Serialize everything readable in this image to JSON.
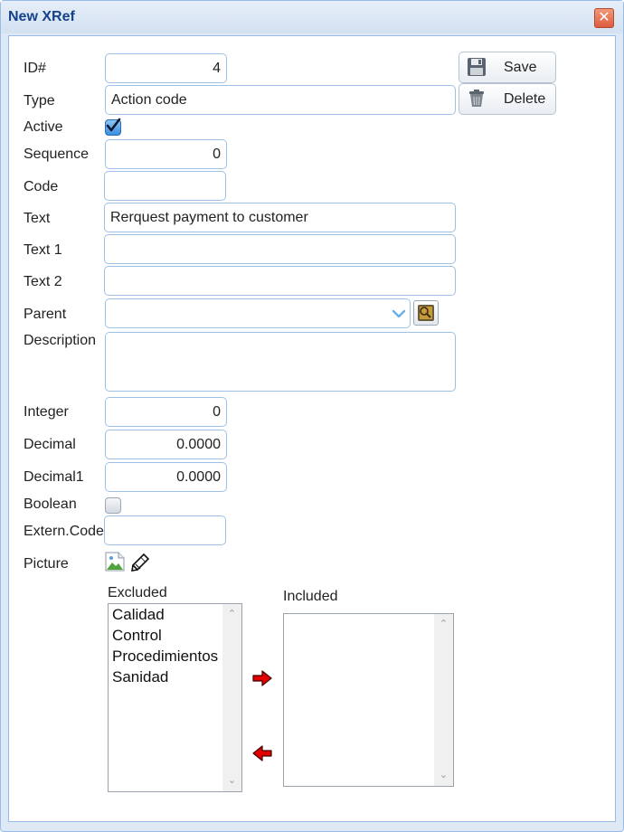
{
  "window": {
    "title": "New XRef",
    "close_icon": "close-icon"
  },
  "form": {
    "id": {
      "label": "ID#",
      "value": "4"
    },
    "type": {
      "label": "Type",
      "value": "Action code"
    },
    "active": {
      "label": "Active",
      "checked": true
    },
    "sequence": {
      "label": "Sequence",
      "value": "0"
    },
    "code": {
      "label": "Code",
      "value": ""
    },
    "text": {
      "label": "Text",
      "value": "Rerquest payment to customer"
    },
    "text1": {
      "label": "Text 1",
      "value": ""
    },
    "text2": {
      "label": "Text 2",
      "value": ""
    },
    "parent": {
      "label": "Parent",
      "value": ""
    },
    "description": {
      "label": "Description",
      "value": ""
    },
    "integer": {
      "label": "Integer",
      "value": "0"
    },
    "decimal": {
      "label": "Decimal",
      "value": "0.0000"
    },
    "decimal1": {
      "label": "Decimal1",
      "value": "0.0000"
    },
    "boolean": {
      "label": "Boolean",
      "checked": false
    },
    "extern_code": {
      "label": "Extern.Code",
      "value": ""
    },
    "picture": {
      "label": "Picture"
    }
  },
  "buttons": {
    "save": "Save",
    "delete": "Delete"
  },
  "lists": {
    "excluded": {
      "label": "Excluded",
      "items": [
        "Calidad",
        "Control",
        "Procedimientos",
        "Sanidad"
      ]
    },
    "included": {
      "label": "Included",
      "items": []
    }
  },
  "colors": {
    "title": "#15428b",
    "border": "#99bbe8",
    "window_bg": "#dfe9f5",
    "arrow": "#e00000"
  }
}
